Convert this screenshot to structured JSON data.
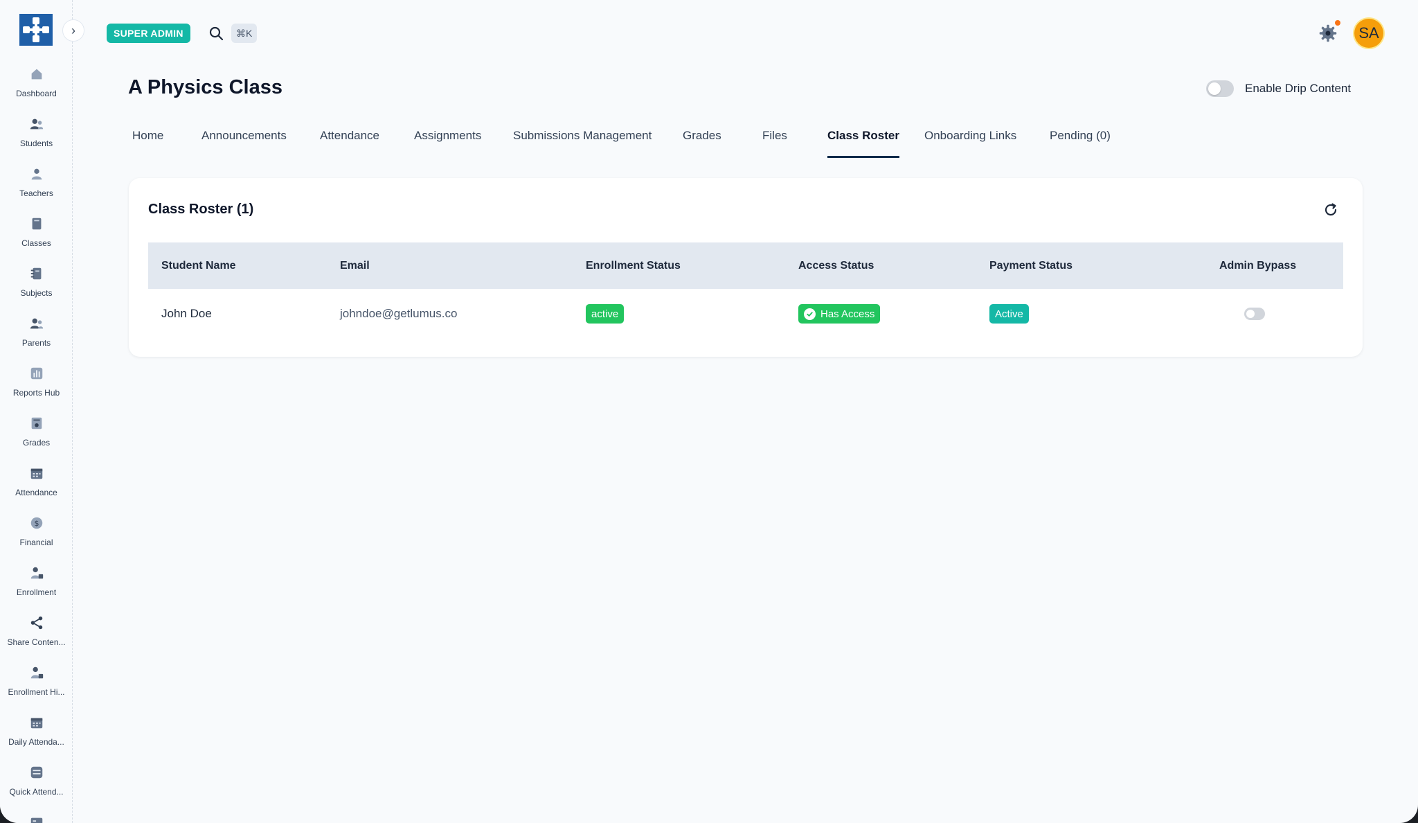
{
  "sidebar": {
    "items": [
      {
        "label": "Dashboard",
        "icon": "home-icon"
      },
      {
        "label": "Students",
        "icon": "users-icon"
      },
      {
        "label": "Teachers",
        "icon": "user-icon"
      },
      {
        "label": "Classes",
        "icon": "book-icon"
      },
      {
        "label": "Subjects",
        "icon": "notebook-icon"
      },
      {
        "label": "Parents",
        "icon": "users-icon"
      },
      {
        "label": "Reports Hub",
        "icon": "bar-chart-icon"
      },
      {
        "label": "Grades",
        "icon": "grades-icon"
      },
      {
        "label": "Attendance",
        "icon": "calendar-icon"
      },
      {
        "label": "Financial",
        "icon": "dollar-icon"
      },
      {
        "label": "Enrollment",
        "icon": "user-plus-icon"
      },
      {
        "label": "Share Conten...",
        "icon": "share-icon"
      },
      {
        "label": "Enrollment Hi...",
        "icon": "user-plus-icon"
      },
      {
        "label": "Daily Attenda...",
        "icon": "calendar-icon"
      },
      {
        "label": "Quick Attend...",
        "icon": "quick-attendance-icon"
      }
    ]
  },
  "topbar": {
    "role_badge": "SUPER ADMIN",
    "shortcut": "⌘K",
    "avatar_initials": "SA"
  },
  "header": {
    "title": "A Physics Class",
    "drip_label": "Enable Drip Content",
    "drip_enabled": false
  },
  "tabs": [
    {
      "label": "Home"
    },
    {
      "label": "Announcements"
    },
    {
      "label": "Attendance"
    },
    {
      "label": "Assignments"
    },
    {
      "label": "Submissions Management"
    },
    {
      "label": "Grades"
    },
    {
      "label": "Files"
    },
    {
      "label": "Class Roster",
      "active": true
    },
    {
      "label": "Onboarding Links"
    },
    {
      "label": "Pending (0)"
    }
  ],
  "roster": {
    "title": "Class Roster (1)",
    "columns": [
      "Student Name",
      "Email",
      "Enrollment Status",
      "Access Status",
      "Payment Status",
      "Admin Bypass"
    ],
    "rows": [
      {
        "name": "John Doe",
        "email": "johndoe@getlumus.co",
        "enrollment": "active",
        "access": "Has Access",
        "payment": "Active",
        "admin_bypass": false
      }
    ]
  },
  "colors": {
    "accent_teal": "#14b8a6",
    "status_green": "#22c55e",
    "brand_blue": "#1f5fa8",
    "avatar_orange": "#f59e0b"
  }
}
